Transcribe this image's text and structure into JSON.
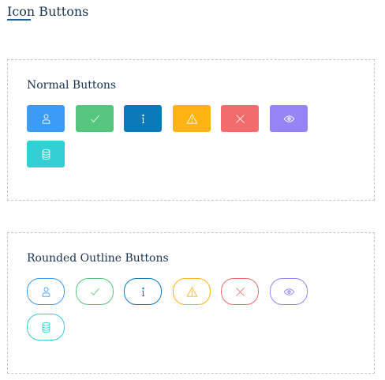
{
  "page": {
    "title": "Icon Buttons"
  },
  "sections": [
    {
      "title": "Normal Buttons",
      "style": "solid"
    },
    {
      "title": "Rounded Outline Buttons",
      "style": "outline"
    }
  ],
  "buttons": [
    {
      "name": "user",
      "color": "#3b9cf6",
      "icon": "user-icon"
    },
    {
      "name": "check",
      "color": "#56c67f",
      "icon": "check-icon"
    },
    {
      "name": "info",
      "color": "#0a79ba",
      "icon": "info-icon"
    },
    {
      "name": "warning",
      "color": "#ffb313",
      "icon": "warning-icon"
    },
    {
      "name": "close",
      "color": "#f36b6b",
      "icon": "close-icon"
    },
    {
      "name": "eye",
      "color": "#9683f4",
      "icon": "eye-icon"
    },
    {
      "name": "database",
      "color": "#32cfd4",
      "icon": "database-icon"
    }
  ]
}
